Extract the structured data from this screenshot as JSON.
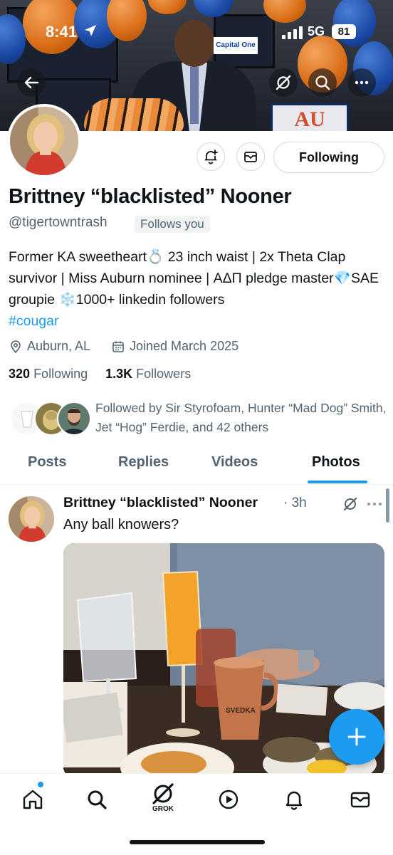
{
  "status_bar": {
    "time": "8:41",
    "network": "5G",
    "battery": "81"
  },
  "banner": {
    "sign_text": "Capital One",
    "au_text": "AU"
  },
  "profile": {
    "display_name": "Brittney “blacklisted” Nooner",
    "handle": "@tigertowntrash",
    "follows_you": "Follows you",
    "follow_button": "Following",
    "bio_text": "Former KA sweetheart💍 23 inch waist | 2x Theta Clap survivor | Miss Auburn nominee | ΑΔΠ pledge master💎SAE groupie ❄️1000+ linkedin followers",
    "bio_hashtag": "#cougar",
    "location": "Auburn, AL",
    "joined": "Joined March 2025",
    "following_count": "320",
    "following_label": "Following",
    "followers_count": "1.3K",
    "followers_label": "Followers",
    "followed_by": "Followed by Sir Styrofoam, Hunter “Mad Dog” Smith, Jet “Hog” Ferdie, and 42 others"
  },
  "tabs": [
    {
      "label": "Posts"
    },
    {
      "label": "Replies"
    },
    {
      "label": "Videos"
    },
    {
      "label": "Photos",
      "active": true
    }
  ],
  "post": {
    "author": "Brittney “blacklisted” Nooner",
    "time": "· 3h",
    "text": "Any ball knowers?",
    "image_mug_text": "SVEDKA"
  },
  "nav": {
    "grok_label": "GROK",
    "icons": [
      "home-icon",
      "search-icon",
      "grok-icon",
      "play-icon",
      "bell-icon",
      "mail-icon"
    ]
  },
  "colors": {
    "accent": "#1d9bf0",
    "secondary_text": "#536471",
    "primary_text": "#0f1419"
  }
}
